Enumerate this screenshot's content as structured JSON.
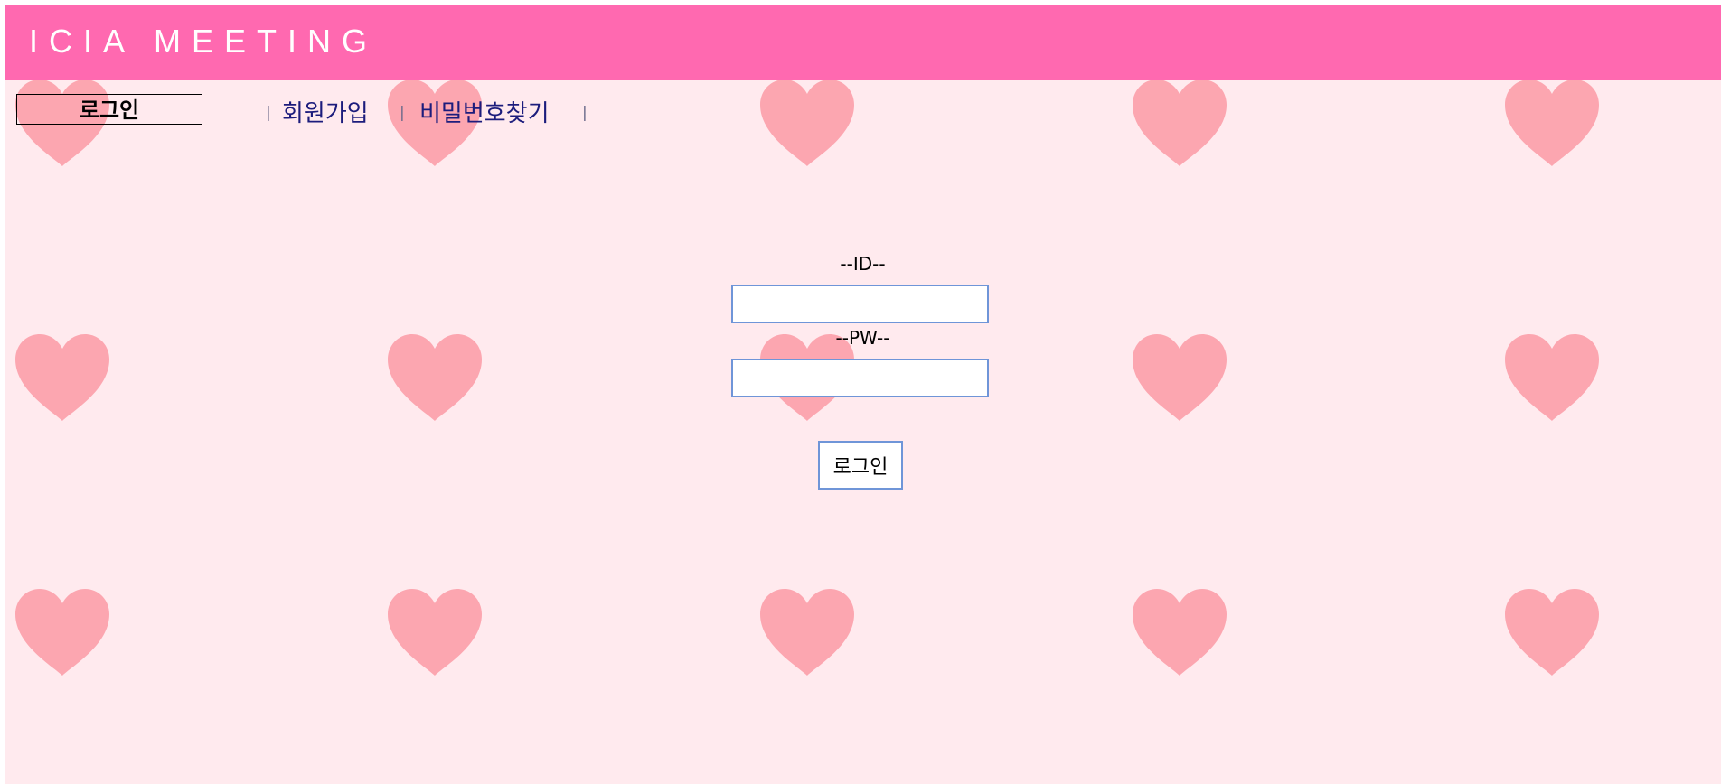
{
  "header": {
    "title": "ICIA MEETING"
  },
  "nav": {
    "login": "로그인",
    "separator": "|",
    "signup": "회원가입",
    "find_password": "비밀번호찾기"
  },
  "form": {
    "id_label": "--ID--",
    "pw_label": "--PW--",
    "id_value": "",
    "pw_value": "",
    "submit_label": "로그인"
  },
  "colors": {
    "header_bg": "#ff69b0",
    "page_bg": "#ffeaee",
    "heart": "#fca6b0",
    "input_border": "#6f95d8",
    "link": "#1c1c7c"
  },
  "icons": {
    "background_pattern": "heart-icon"
  }
}
